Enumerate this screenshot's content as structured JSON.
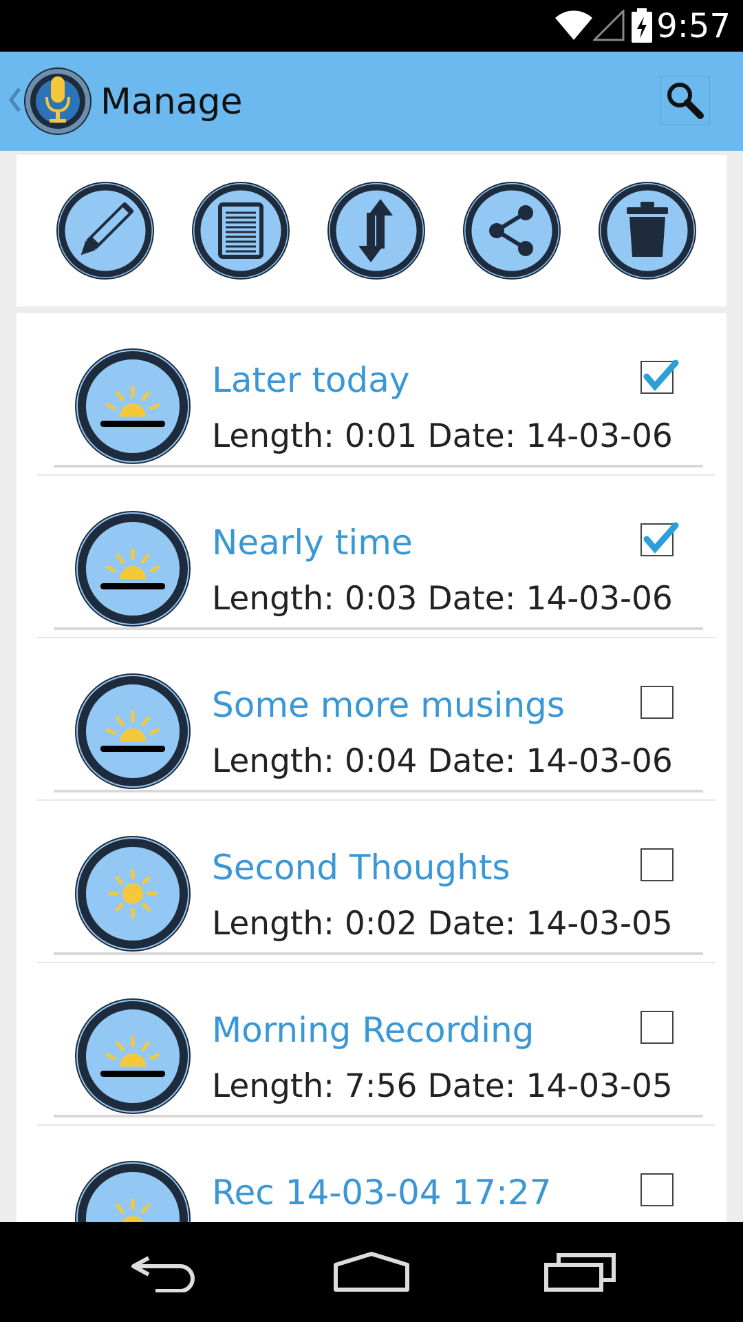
{
  "status_bar": {
    "time": "9:57",
    "icons": [
      "wifi-icon",
      "cell-signal-icon",
      "battery-charging-icon"
    ]
  },
  "action_bar": {
    "title": "Manage",
    "background": "#6cb9ef",
    "icons": [
      "up-caret-icon",
      "microphone-logo-icon",
      "search-icon"
    ]
  },
  "toolbar": {
    "buttons": [
      {
        "name": "edit-button",
        "icon": "pencil-icon"
      },
      {
        "name": "details-button",
        "icon": "document-icon"
      },
      {
        "name": "sort-button",
        "icon": "up-down-arrows-icon"
      },
      {
        "name": "share-button",
        "icon": "share-icon"
      },
      {
        "name": "delete-button",
        "icon": "trash-icon"
      }
    ]
  },
  "recordings": [
    {
      "title": "Later today",
      "meta": "Length: 0:01 Date: 14-03-06",
      "checked": true,
      "icon": "sunrise-icon"
    },
    {
      "title": "Nearly time",
      "meta": "Length: 0:03 Date: 14-03-06",
      "checked": true,
      "icon": "sunrise-icon"
    },
    {
      "title": "Some more musings",
      "meta": "Length: 0:04 Date: 14-03-06",
      "checked": false,
      "icon": "sunrise-icon"
    },
    {
      "title": "Second Thoughts",
      "meta": "Length: 0:02 Date: 14-03-05",
      "checked": false,
      "icon": "sun-icon"
    },
    {
      "title": "Morning Recording",
      "meta": "Length: 7:56 Date: 14-03-05",
      "checked": false,
      "icon": "sunrise-icon"
    },
    {
      "title": "Rec 14-03-04 17:27",
      "meta": "",
      "checked": false,
      "icon": "sunrise-icon"
    }
  ],
  "nav_bar": {
    "buttons": [
      "back-icon",
      "home-icon",
      "recents-icon"
    ]
  },
  "colors": {
    "accent_title": "#3a97d6",
    "icon_fill": "#93c8f5",
    "icon_dark": "#1e2b3c",
    "sun": "#f5c83a",
    "check": "#2a9fd8"
  }
}
